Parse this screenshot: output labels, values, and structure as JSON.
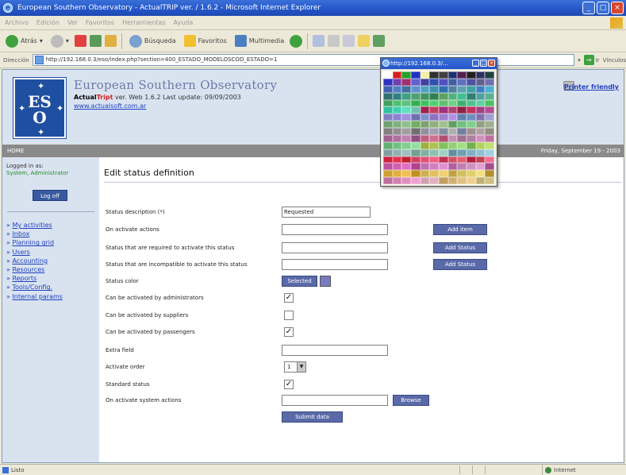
{
  "window": {
    "title": "European Southern Observatory - ActualTRIP ver. / 1.6.2 - Microsoft Internet Explorer"
  },
  "menubar": [
    "Archivo",
    "Edición",
    "Ver",
    "Favoritos",
    "Herramientas",
    "Ayuda"
  ],
  "toolbar": {
    "back": "Atrás",
    "search": "Búsqueda",
    "favorites": "Favoritos",
    "multimedia": "Multimedia"
  },
  "address": {
    "label": "Dirección",
    "url": "http://192.168.0.3/eso/index.php?section=400_ESTADO_MODELOSCOD_ESTADO=1",
    "go": "Ir",
    "links": "Vínculos"
  },
  "site": {
    "org": "European Southern Observatory",
    "product_a": "Actual",
    "product_b": "Tript",
    "version_text": " ver. Web 1.6.2 Last update: 09/09/2003",
    "website": "www.actualsoft.com.ar",
    "print_label": "Printer friendly"
  },
  "navbar": {
    "home": "HOME",
    "date": "Friday, September 19 - 2003"
  },
  "sidebar": {
    "logged_in_label": "Logged in as:",
    "user": "System, Administrator",
    "logoff": "Log off",
    "items": [
      "My activities",
      "Inbox",
      "Planning grid",
      "Users",
      "Accounting",
      "Resources",
      "Reports",
      "Tools/Config.",
      "Internal params"
    ]
  },
  "form": {
    "title": "Edit status definition",
    "fields": {
      "status_description": {
        "label": "Status description (*)",
        "value": "Requested"
      },
      "on_activate_actions": {
        "label": "On activate actions",
        "value": "",
        "button": "Add item"
      },
      "required_status": {
        "label": "Status that are required to activate this status",
        "value": "",
        "button": "Add Status"
      },
      "incompatible_status": {
        "label": "Status that are incompatible to activate this status",
        "value": "",
        "button": "Add Status"
      },
      "status_color": {
        "label": "Status color",
        "button": "Selected"
      },
      "by_admins": {
        "label": "Can be activated by administrators",
        "checked": true
      },
      "by_suppliers": {
        "label": "Can be activated by suppliers",
        "checked": false
      },
      "by_passengers": {
        "label": "Can be activated by passengers",
        "checked": true
      },
      "extra_field": {
        "label": "Extra field",
        "value": ""
      },
      "activate_order": {
        "label": "Activate order",
        "value": "1"
      },
      "standard_status": {
        "label": "Standard status",
        "checked": true
      },
      "system_actions": {
        "label": "On activate system actions",
        "value": "",
        "button": "Browse"
      }
    },
    "submit": "Submit data"
  },
  "color_popup": {
    "title": "http://192.168.0.3/...",
    "colors": [
      "#ffffff",
      "#d42020",
      "#2aa02a",
      "#2030c0",
      "#f0f0a0",
      "#303030",
      "#404040",
      "#203070",
      "#502050",
      "#202020",
      "#303060",
      "#204040",
      "#3030c0",
      "#7040b0",
      "#a03070",
      "#6060d0",
      "#4040a0",
      "#3050b0",
      "#5050c0",
      "#4060a0",
      "#6070c0",
      "#5050a0",
      "#606090",
      "#7070b0",
      "#4060b0",
      "#5080c0",
      "#4070a0",
      "#6090d0",
      "#50a0c0",
      "#4090b0",
      "#3070b0",
      "#5080a0",
      "#60a0b0",
      "#40a0a0",
      "#4080c0",
      "#50b0d0",
      "#307070",
      "#308080",
      "#40a080",
      "#50a070",
      "#409060",
      "#308050",
      "#60a060",
      "#50b080",
      "#40c090",
      "#308070",
      "#50a0a0",
      "#60b090",
      "#40a060",
      "#50c070",
      "#60c080",
      "#30b050",
      "#40c060",
      "#50d070",
      "#60c070",
      "#70d080",
      "#40b070",
      "#50c090",
      "#60d0a0",
      "#50c060",
      "#30c0a0",
      "#40d0b0",
      "#60e0c0",
      "#70c0b0",
      "#a02050",
      "#c04060",
      "#a03080",
      "#b04070",
      "#902040",
      "#c03060",
      "#a04080",
      "#b05090",
      "#8080c0",
      "#9080d0",
      "#a090e0",
      "#7070b0",
      "#8090d0",
      "#9070c0",
      "#a080d0",
      "#b090e0",
      "#6080b0",
      "#7090c0",
      "#8070b0",
      "#a0a0d0",
      "#70a070",
      "#80b080",
      "#90c090",
      "#70b060",
      "#80a070",
      "#90b080",
      "#a0c090",
      "#60a060",
      "#70c080",
      "#80d090",
      "#90a080",
      "#a0b090",
      "#808080",
      "#909090",
      "#a0a0a0",
      "#707070",
      "#9090a0",
      "#a0a0b0",
      "#8090a0",
      "#b0b0b0",
      "#7080a0",
      "#a09090",
      "#b0a0a0",
      "#909080",
      "#a06090",
      "#b070a0",
      "#c080b0",
      "#905080",
      "#c06080",
      "#d07090",
      "#b05070",
      "#c090b0",
      "#a07090",
      "#b080a0",
      "#d090c0",
      "#c070a0",
      "#60b070",
      "#70c080",
      "#80d090",
      "#90e0a0",
      "#a0b040",
      "#b0c050",
      "#80c060",
      "#90d070",
      "#a0e080",
      "#70b050",
      "#b0d060",
      "#c0e070",
      "#80a0a0",
      "#90b0b0",
      "#a0c0c0",
      "#70a090",
      "#80b0a0",
      "#90c0b0",
      "#a0d0c0",
      "#6090a0",
      "#70a0b0",
      "#80b0c0",
      "#90c0d0",
      "#a0d0e0",
      "#d02040",
      "#e03050",
      "#c02030",
      "#d04060",
      "#e05070",
      "#f06080",
      "#c03050",
      "#d05060",
      "#e06070",
      "#b02040",
      "#c04050",
      "#f07090",
      "#c050a0",
      "#d060b0",
      "#e070c0",
      "#b04090",
      "#c070b0",
      "#d080c0",
      "#e090d0",
      "#b060a0",
      "#c080b0",
      "#d090c0",
      "#e0a0d0",
      "#a05090",
      "#d0a030",
      "#e0b040",
      "#f0c050",
      "#c09020",
      "#d0b050",
      "#e0c060",
      "#f0d070",
      "#c0a040",
      "#d0c060",
      "#e0d070",
      "#f0e080",
      "#b09030",
      "#c070a0",
      "#d080b0",
      "#e090c0",
      "#f0a0d0",
      "#d0a0b0",
      "#e0b0c0",
      "#c0a060",
      "#d0b070",
      "#e0c080",
      "#f0d090",
      "#c0b070",
      "#d0c080"
    ]
  },
  "statusbar": {
    "left": "Listo",
    "zone": "Internet"
  }
}
